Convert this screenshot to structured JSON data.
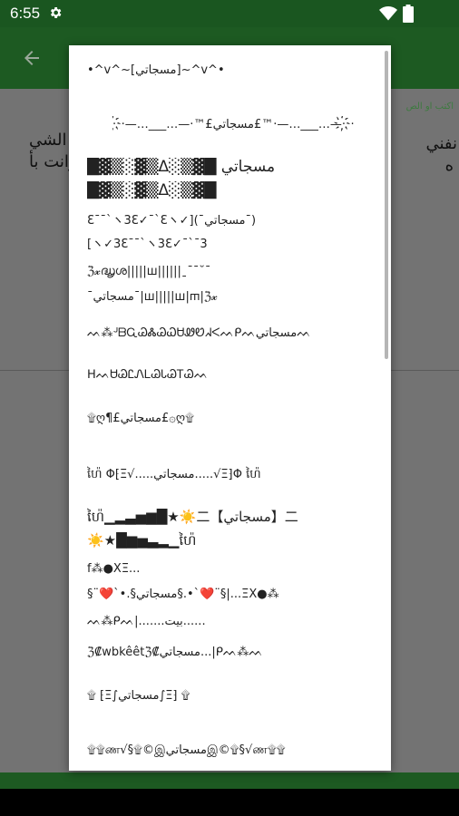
{
  "status_bar": {
    "time": "6:55",
    "icons": [
      "gear-icon",
      "wifi-icon",
      "battery-icon"
    ]
  },
  "app_bar": {
    "back_icon": "arrow-left-icon"
  },
  "background_content": {
    "hint": "اكتب او الص",
    "line1": "لو الشي",
    "line2": "وانت بأ",
    "right1": "نفني",
    "right2": "ه"
  },
  "dialog": {
    "items": [
      "•^v^~[مسجاتي]~^v^•",
      "·҉·—…___…—·™£مسجاتي£™·—…___…—·҉·",
      "█▓▒░▓▒Δ░▒▓█ مسجاتي",
      "█▓▒░▓▒Δ░▒▓█",
      "Ɛ¯¯`ヽ3Ɛ✓¯`Ɛヽ✓](¯مسجاتي¯)",
      "[ヽ✓3Ɛ¯¯`ヽ3Ɛ✓¯`¯3",
      "ℨ𝔁ദ്ധൄശ|||||ш||||||ˍ¯¯˘¯",
      "¯مسجاتي¯|ш|||||ш|ᲅ|ℨ𝔁",
      "ᨓ⁂ᒢᗷᏩᏊᏜᏊᏇᏌᏪᏬᖽᐸᨓᑭᨓمسجاتيᨓ",
      "ᕼᨓᏌᏊᏝᏁᏞᏊᏓᏊᎢᏊᨓ",
      "۩ღ¶£مسجاتي£۞ღ۩",
      "ហ៉ៃ Φ⁅Ξ√.....مسجاتي.....√Ξ⁆Φ ហ៉ៃ",
      "ហ៉ៃ▁▂▃▅▆█★☀️二【مسجاتي】二",
      "☀️★█▆▅▃▂▁ហ៉ៃ",
      "f⁂●XΞ...",
      "§¨❤️`•.§مسجاتي§.•`❤️¨§|...ΞX●⁂",
      "ᨓ⁂ᑭᨓ|.......بيت......",
      "ℨ₡wbkêêtℨ₡مسجاتي...|ᑭᨓ⁂ᨓ",
      "۩ ⁅Ξ∫مسجاتي∫Ξ⁆ ۩",
      "۩۩ண√§۩©இمسجاتيஇ©۩§√ண۩۩"
    ]
  }
}
